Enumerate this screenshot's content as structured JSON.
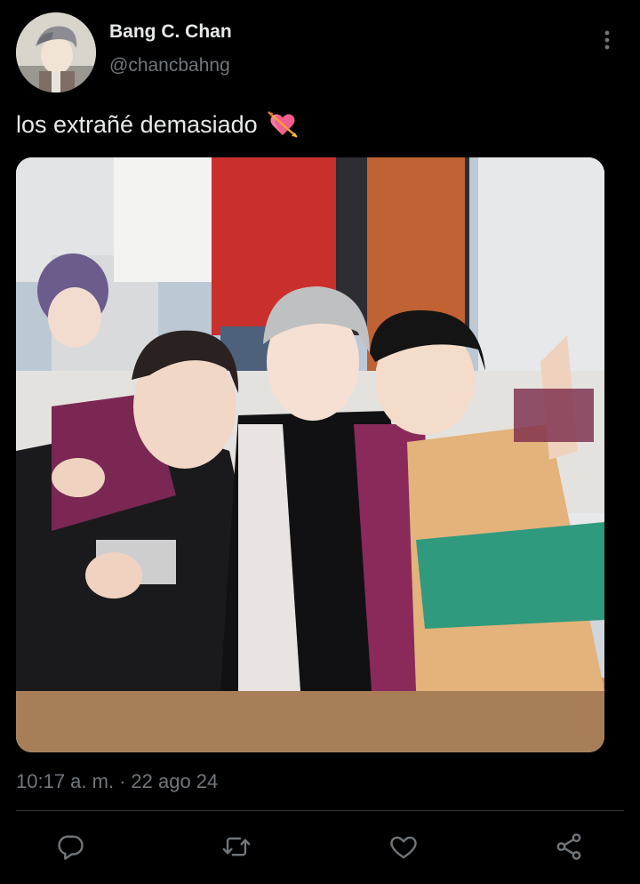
{
  "author": {
    "display_name": "Bang C. Chan",
    "handle": "@chancbahng",
    "avatar_icon": "profile-avatar"
  },
  "tweet": {
    "text": "los extrañé demasiado",
    "emoji": "heart-with-arrow-emoji",
    "time": "10:17 a. m.",
    "separator": "·",
    "date": "22 ago 24",
    "media_description_icon": "photo"
  },
  "actions": {
    "reply_icon": "reply-icon",
    "retweet_icon": "retweet-icon",
    "like_icon": "heart-icon",
    "share_icon": "share-icon",
    "more_icon": "more-vertical-icon"
  },
  "colors": {
    "background": "#000000",
    "text_primary": "#e7e9ea",
    "text_secondary": "#71767b",
    "divider": "#2f3336",
    "emoji_heart": "#f25d8e"
  }
}
